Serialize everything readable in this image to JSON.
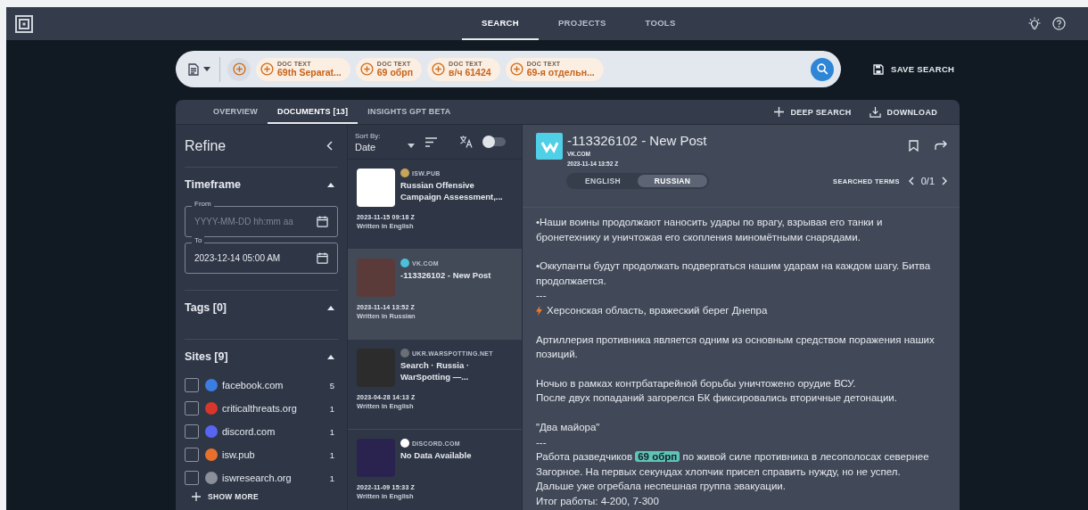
{
  "nav": {
    "tabs": [
      {
        "label": "SEARCH",
        "selected": true
      },
      {
        "label": "PROJECTS",
        "selected": false
      },
      {
        "label": "TOOLS",
        "selected": false
      }
    ]
  },
  "search": {
    "chips": [
      {
        "label": "DOC TEXT",
        "value": "69th Separat..."
      },
      {
        "label": "DOC TEXT",
        "value": "69 обрп"
      },
      {
        "label": "DOC TEXT",
        "value": "в/ч 61424"
      },
      {
        "label": "DOC TEXT",
        "value": "69-я отдельн..."
      }
    ],
    "save": "SAVE SEARCH"
  },
  "panel_tabs": [
    {
      "label": "OVERVIEW",
      "selected": false
    },
    {
      "label": "DOCUMENTS [13]",
      "selected": true
    },
    {
      "label": "INSIGHTS GPT BETA",
      "selected": false
    }
  ],
  "actions": [
    "DEEP SEARCH",
    "DOWNLOAD"
  ],
  "refine": {
    "title": "Refine",
    "timeframe": {
      "title": "Timeframe",
      "expanded": true,
      "from": {
        "label": "From",
        "placeholder": "YYYY-MM-DD hh:mm aa"
      },
      "to": {
        "label": "To",
        "value": "2023-12-14 05:00 AM"
      }
    },
    "tags": {
      "title": "Tags [0]",
      "expanded": true
    },
    "sites": {
      "title": "Sites [9]",
      "expanded": true,
      "items": [
        {
          "name": "facebook.com",
          "count": "5",
          "checked": false,
          "color": "#3b7de0"
        },
        {
          "name": "criticalthreats.org",
          "count": "1",
          "checked": false,
          "color": "#d8362b"
        },
        {
          "name": "discord.com",
          "count": "1",
          "checked": false,
          "color": "#5865f2"
        },
        {
          "name": "isw.pub",
          "count": "1",
          "checked": false,
          "color": "#e8702a"
        },
        {
          "name": "iswresearch.org",
          "count": "1",
          "checked": false,
          "color": "#8a8f99"
        }
      ],
      "more": "SHOW MORE"
    }
  },
  "sort": {
    "label": "Sort By:",
    "value": "Date",
    "translate_on": false
  },
  "documents": [
    {
      "site": "ISW.PUB",
      "title": "Russian Offensive Campaign Assessment,...",
      "date": "2023-11-15 09:18 Z",
      "language": "Written in English",
      "selected": false,
      "color": "#c8a35a"
    },
    {
      "site": "VK.COM",
      "title": "-113326102 - New Post",
      "date": "2023-11-14 13:52 Z",
      "language": "Written in Russian",
      "selected": true,
      "color": "#4bc0da"
    },
    {
      "site": "UKR.WARSPOTTING.NET",
      "title": "Search · Russia · WarSpotting —...",
      "date": "2023-04-28 14:13 Z",
      "language": "Written in English",
      "selected": false,
      "color": "#6a6e75"
    },
    {
      "site": "DISCORD.COM",
      "title": "No Data Available",
      "date": "2022-11-09 15:33 Z",
      "language": "Written in English",
      "selected": false,
      "color": "#ffffff"
    }
  ],
  "detail": {
    "title": "-113326102 - New Post",
    "site": "VK.COM",
    "date": "2023-11-14 13:52 Z",
    "languages": [
      {
        "label": "ENGLISH",
        "selected": false
      },
      {
        "label": "RUSSIAN",
        "selected": true
      }
    ],
    "terms_label": "SEARCHED TERMS",
    "terms_count": "0/1",
    "blocks": [
      {
        "lines": [
          "•Наши воины продолжают наносить удары по врагу, взрывая его танки и бронетехнику и уничтожая его скопления миномётными снарядами."
        ]
      },
      {
        "lines": [
          "•Оккупанты будут продолжать подвергаться нашим ударам на каждом шагу. Битва продолжается.",
          "---",
          {
            "kind": "bolt",
            "parts": [
              {
                "text": "Херсонская область, вражеский берег Днепра",
                "highlight": false
              }
            ]
          }
        ]
      },
      {
        "lines": [
          "Артиллерия противника является одним из основным средством поражения наших позиций."
        ]
      },
      {
        "lines": [
          "Ночью в рамках контрбатарейной борьбы уничтожено орудие ВСУ.",
          "После двух попаданий загорелся БК фиксировались вторичные детонации."
        ]
      },
      {
        "lines": [
          "\"Два майора\"",
          "---",
          {
            "kind": "text",
            "parts": [
              {
                "text": "Работа разведчиков ",
                "highlight": false
              },
              {
                "text": "69 обрп",
                "highlight": true
              },
              {
                "text": " по живой силе противника в лесополосах севернее Загорное. На первых секундах хлопчик присел справить нужду, но не успел.",
                "highlight": false
              }
            ]
          },
          "Дальше уже огребала неспешная группа эвакуации.",
          "Итог работы: 4-200, 7-300"
        ]
      }
    ]
  }
}
